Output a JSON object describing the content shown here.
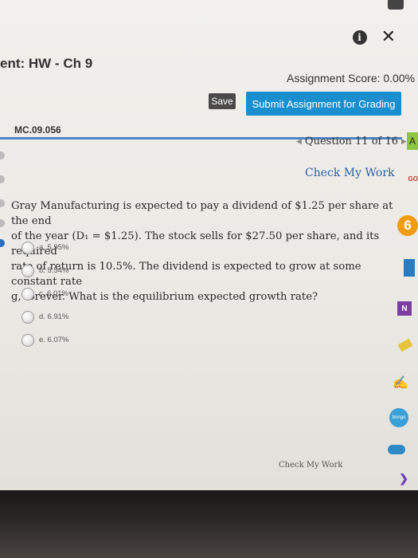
{
  "header": {
    "title": "ent: HW - Ch 9",
    "assignment_score": "Assignment Score: 0.00%",
    "save_label": "Save",
    "submit_label": "Submit Assignment for Grading"
  },
  "question": {
    "id": "MC.09.056",
    "nav": "Question 11 of 16",
    "check_my_work_top": "Check My Work",
    "text_lines": [
      "Gray Manufacturing is expected to pay a dividend of $1.25 per share at the end",
      "of the year (D₁ = $1.25). The stock sells for $27.50 per share, and its required",
      "rate of return is 10.5%. The dividend is expected to grow at some constant rate",
      "g, forever. What is the equilibrium expected growth rate?"
    ],
    "options": [
      {
        "label": "a. 5.95%"
      },
      {
        "label": "b. 5.54%"
      },
      {
        "label": "c. 6.01%"
      },
      {
        "label": "d. 6.91%"
      },
      {
        "label": "e. 6.07%"
      }
    ],
    "check_my_work_bottom": "Check My Work"
  },
  "right_rail": {
    "letter_a": "A",
    "go": "GO",
    "onenote": "N",
    "bongo": "bongo"
  },
  "icons": [
    "info-icon",
    "close-icon",
    "prev-arrow-icon",
    "next-arrow-icon"
  ],
  "colors": {
    "submit_button": "#1a8fcf",
    "save_button": "#4a4a4a",
    "divider": "#4f86c6",
    "link": "#2c5fa6"
  }
}
